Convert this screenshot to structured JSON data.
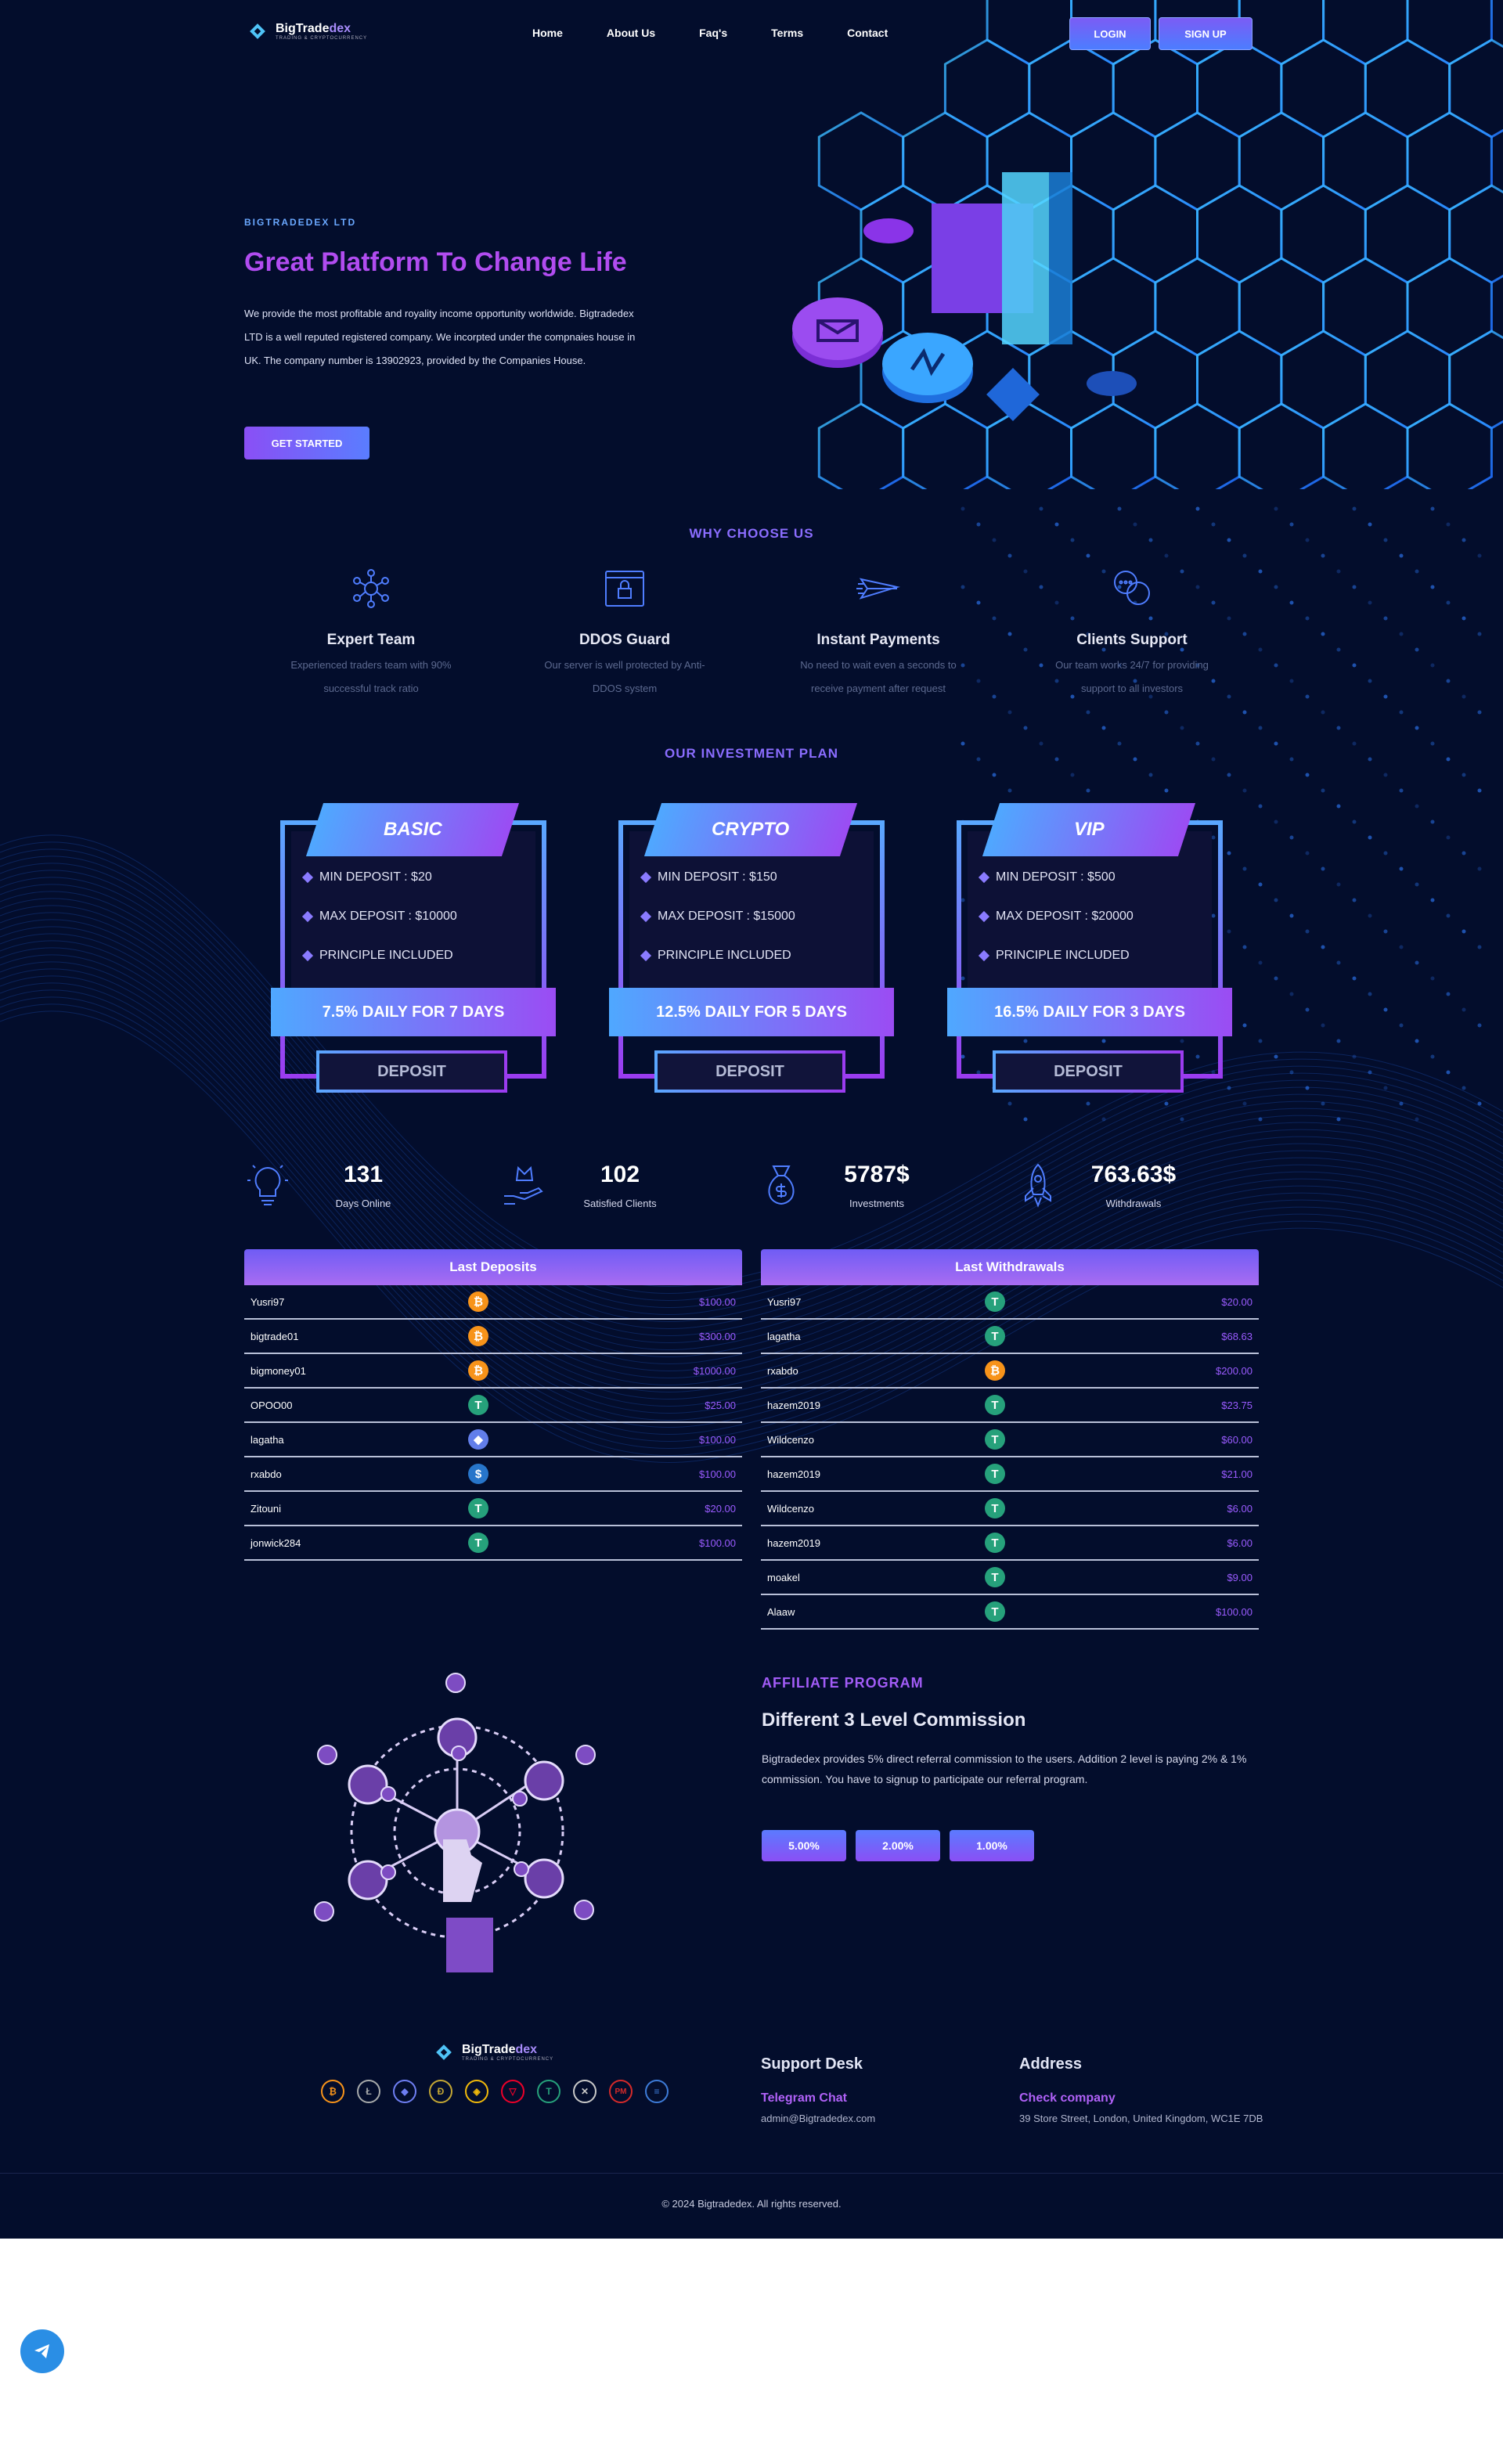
{
  "header": {
    "logo_main": "BigTrade",
    "logo_accent": "dex",
    "logo_tag": "TRADING & CRYPTOCURRENCY",
    "nav": [
      "Home",
      "About Us",
      "Faq's",
      "Terms",
      "Contact"
    ],
    "login": "LOGIN",
    "signup": "SIGN UP"
  },
  "hero": {
    "eyebrow": "BIGTRADEDEX LTD",
    "title": "Great Platform To Change Life",
    "text": "We provide the most profitable and royality income opportunity worldwide. Bigtradedex LTD is a well reputed registered company. We incorpted under the compnaies house in UK. The company number is 13902923, provided by the Companies House.",
    "cta": "GET STARTED"
  },
  "why": {
    "title": "WHY CHOOSE US",
    "features": [
      {
        "title": "Expert Team",
        "text": "Experienced traders team with 90% successful track ratio",
        "icon": "network-icon"
      },
      {
        "title": "DDOS Guard",
        "text": "Our server is well protected by Anti-DDOS system",
        "icon": "lock-window-icon"
      },
      {
        "title": "Instant Payments",
        "text": "No need to wait even a seconds to receive payment after request",
        "icon": "paper-plane-icon"
      },
      {
        "title": "Clients Support",
        "text": "Our team works 24/7 for providing support to all investors",
        "icon": "chat-bubbles-icon"
      }
    ]
  },
  "plans": {
    "title": "OUR INVESTMENT PLAN",
    "items": [
      {
        "name": "BASIC",
        "min": "MIN DEPOSIT : $20",
        "max": "MAX DEPOSIT : $10000",
        "principle": "PRINCIPLE INCLUDED",
        "rate": "7.5% DAILY FOR 7 DAYS",
        "button": "DEPOSIT"
      },
      {
        "name": "CRYPTO",
        "min": "MIN DEPOSIT : $150",
        "max": "MAX DEPOSIT : $15000",
        "principle": "PRINCIPLE INCLUDED",
        "rate": "12.5% DAILY FOR 5 DAYS",
        "button": "DEPOSIT"
      },
      {
        "name": "VIP",
        "min": "MIN DEPOSIT : $500",
        "max": "MAX DEPOSIT : $20000",
        "principle": "PRINCIPLE INCLUDED",
        "rate": "16.5% DAILY FOR 3 DAYS",
        "button": "DEPOSIT"
      }
    ]
  },
  "stats": [
    {
      "value": "131",
      "label": "Days Online",
      "icon": "lightbulb-icon"
    },
    {
      "value": "102",
      "label": "Satisfied Clients",
      "icon": "crown-hand-icon"
    },
    {
      "value": "5787$",
      "label": "Investments",
      "icon": "money-bag-icon"
    },
    {
      "value": "763.63$",
      "label": "Withdrawals",
      "icon": "rocket-icon"
    }
  ],
  "deposits": {
    "title": "Last Deposits",
    "rows": [
      {
        "user": "Yusri97",
        "coin": "btc",
        "amount": "$100.00"
      },
      {
        "user": "bigtrade01",
        "coin": "btc",
        "amount": "$300.00"
      },
      {
        "user": "bigmoney01",
        "coin": "btc",
        "amount": "$1000.00"
      },
      {
        "user": "OPOO00",
        "coin": "usdt",
        "amount": "$25.00"
      },
      {
        "user": "lagatha",
        "coin": "eth",
        "amount": "$100.00"
      },
      {
        "user": "rxabdo",
        "coin": "usd",
        "amount": "$100.00"
      },
      {
        "user": "Zitouni",
        "coin": "usdt",
        "amount": "$20.00"
      },
      {
        "user": "jonwick284",
        "coin": "usdt",
        "amount": "$100.00"
      }
    ]
  },
  "withdrawals": {
    "title": "Last Withdrawals",
    "rows": [
      {
        "user": "Yusri97",
        "coin": "usdt",
        "amount": "$20.00"
      },
      {
        "user": "lagatha",
        "coin": "usdt",
        "amount": "$68.63"
      },
      {
        "user": "rxabdo",
        "coin": "btc",
        "amount": "$200.00"
      },
      {
        "user": "hazem2019",
        "coin": "usdt",
        "amount": "$23.75"
      },
      {
        "user": "Wildcenzo",
        "coin": "usdt",
        "amount": "$60.00"
      },
      {
        "user": "hazem2019",
        "coin": "usdt",
        "amount": "$21.00"
      },
      {
        "user": "Wildcenzo",
        "coin": "usdt",
        "amount": "$6.00"
      },
      {
        "user": "hazem2019",
        "coin": "usdt",
        "amount": "$6.00"
      },
      {
        "user": "moakel",
        "coin": "usdt",
        "amount": "$9.00"
      },
      {
        "user": "Alaaw",
        "coin": "usdt",
        "amount": "$100.00"
      }
    ]
  },
  "affiliate": {
    "eyebrow": "AFFILIATE PROGRAM",
    "title": "Different 3 Level Commission",
    "text": "Bigtradedex provides 5% direct referral commission to the users. Addition 2 level is paying 2% & 1% commission. You have to signup to participate our referral program.",
    "levels": [
      "5.00%",
      "2.00%",
      "1.00%"
    ]
  },
  "footer": {
    "support_title": "Support Desk",
    "support_link": "Telegram Chat",
    "support_email": "admin@Bigtradedex.com",
    "address_title": "Address",
    "address_link": "Check company",
    "address_text": "39 Store Street, London, United Kingdom, WC1E 7DB",
    "coins": [
      "bitcoin",
      "litecoin",
      "ethereum",
      "dogecoin",
      "binance",
      "tron",
      "tether",
      "ripple",
      "perfect-money",
      "dash"
    ],
    "copyright": "© 2024 Bigtradedex. All rights reserved."
  },
  "colors": {
    "background": "#030d2c",
    "accent": "#8b6dff",
    "purple": "#b14cf0",
    "btc": "#f7931a",
    "usdt": "#26a17b",
    "eth": "#627eea",
    "usd": "#2775ca"
  }
}
